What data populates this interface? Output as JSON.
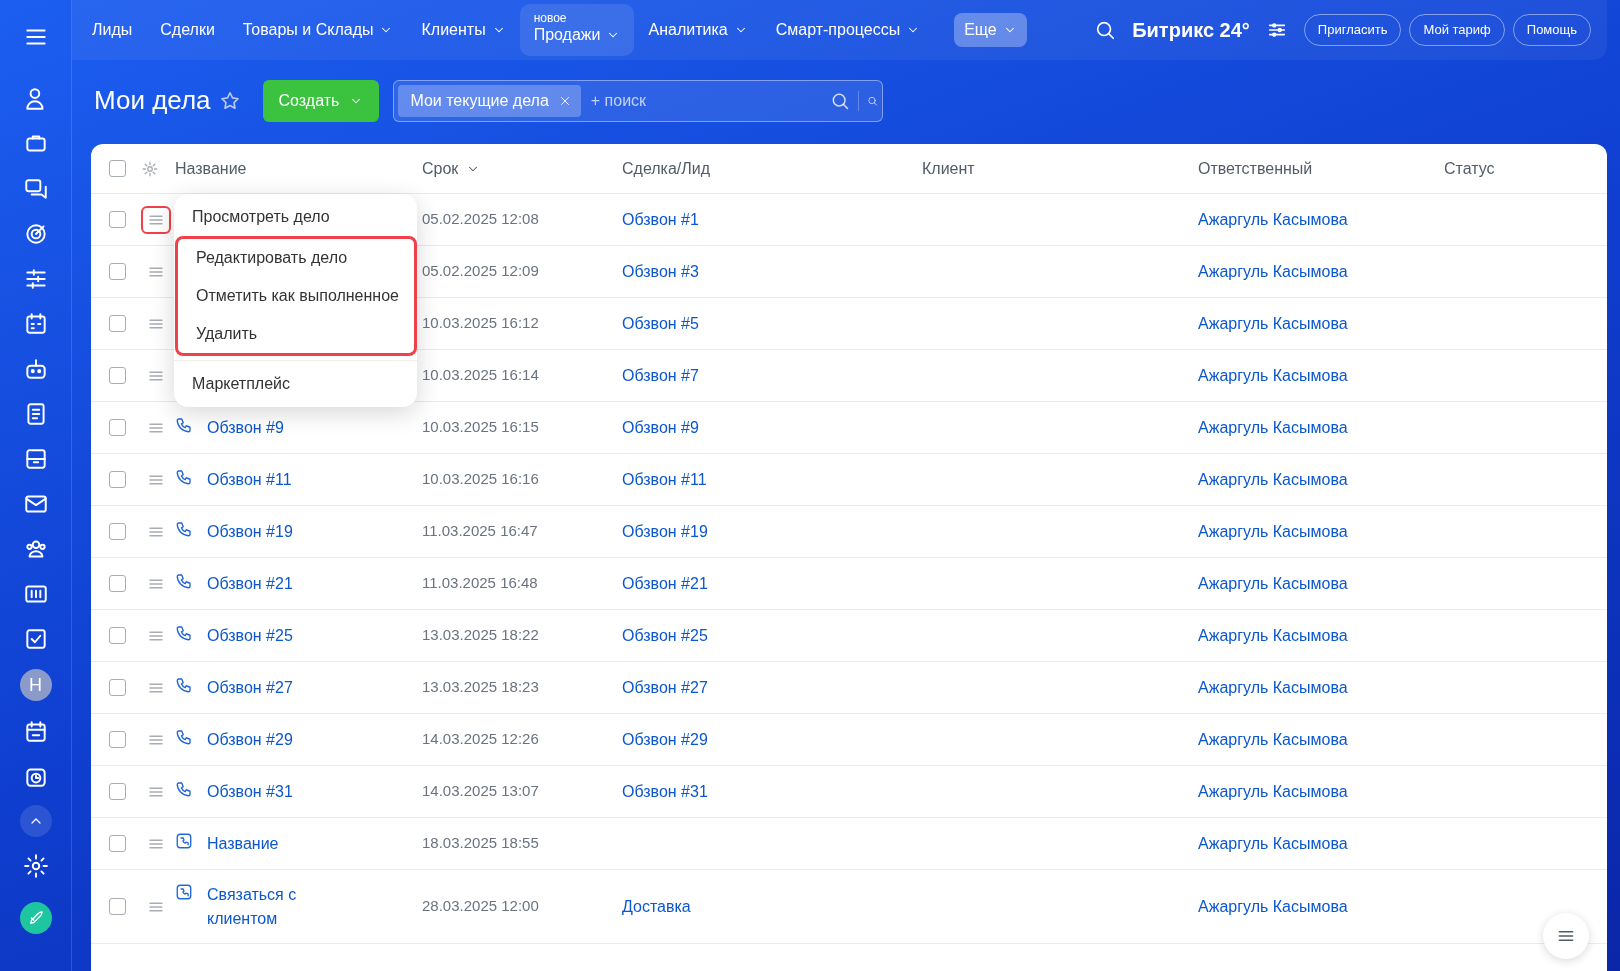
{
  "topbar": {
    "nav": [
      {
        "label": "Лиды",
        "dropdown": false
      },
      {
        "label": "Сделки",
        "dropdown": false
      },
      {
        "label": "Товары и Склады",
        "dropdown": true
      },
      {
        "label": "Клиенты",
        "dropdown": true
      },
      {
        "label": "Продажи",
        "dropdown": true,
        "tag": "новое"
      },
      {
        "label": "Аналитика",
        "dropdown": true
      },
      {
        "label": "Смарт-процессы",
        "dropdown": true
      }
    ],
    "more": "Еще",
    "logo": "Битрикс 24°",
    "buttons": [
      "Пригласить",
      "Мой тариф",
      "Помощь"
    ]
  },
  "sidebar": {
    "avatar": "H"
  },
  "page": {
    "title": "Мои дела",
    "create": "Создать",
    "filter": {
      "chip": "Мои текущие дела",
      "placeholder": "+ поиск"
    }
  },
  "table": {
    "select_all": false,
    "columns": [
      "Название",
      "Срок",
      "Сделка/Лид",
      "Клиент",
      "Ответственный",
      "Статус"
    ],
    "rows": [
      {
        "checked": false,
        "menu_highlighted": true,
        "due": "05.02.2025 12:08",
        "deal": "Обзвон #1",
        "owner": "Ажаргуль Касымова"
      },
      {
        "checked": false,
        "due": "05.02.2025 12:09",
        "deal": "Обзвон #3",
        "owner": "Ажаргуль Касымова"
      },
      {
        "checked": false,
        "due": "10.03.2025 16:12",
        "deal": "Обзвон #5",
        "owner": "Ажаргуль Касымова"
      },
      {
        "checked": false,
        "due": "10.03.2025 16:14",
        "deal": "Обзвон #7",
        "owner": "Ажаргуль Касымова"
      },
      {
        "checked": false,
        "kind": "call",
        "name": "Обзвон #9",
        "due": "10.03.2025 16:15",
        "deal": "Обзвон #9",
        "owner": "Ажаргуль Касымова"
      },
      {
        "checked": false,
        "kind": "call",
        "name": "Обзвон #11",
        "due": "10.03.2025 16:16",
        "deal": "Обзвон #11",
        "owner": "Ажаргуль Касымова"
      },
      {
        "checked": false,
        "kind": "call",
        "name": "Обзвон #19",
        "due": "11.03.2025 16:47",
        "deal": "Обзвон #19",
        "owner": "Ажаргуль Касымова"
      },
      {
        "checked": false,
        "kind": "call",
        "name": "Обзвон #21",
        "due": "11.03.2025 16:48",
        "deal": "Обзвон #21",
        "owner": "Ажаргуль Касымова"
      },
      {
        "checked": false,
        "kind": "call",
        "name": "Обзвон #25",
        "due": "13.03.2025 18:22",
        "deal": "Обзвон #25",
        "owner": "Ажаргуль Касымова"
      },
      {
        "checked": false,
        "kind": "call",
        "name": "Обзвон #27",
        "due": "13.03.2025 18:23",
        "deal": "Обзвон #27",
        "owner": "Ажаргуль Касымова"
      },
      {
        "checked": false,
        "kind": "call",
        "name": "Обзвон #29",
        "due": "14.03.2025 12:26",
        "deal": "Обзвон #29",
        "owner": "Ажаргуль Касымова"
      },
      {
        "checked": false,
        "kind": "call",
        "name": "Обзвон #31",
        "due": "14.03.2025 13:07",
        "deal": "Обзвон #31",
        "owner": "Ажаргуль Касымова"
      },
      {
        "checked": false,
        "kind": "task",
        "name": "Название",
        "due": "18.03.2025 18:55",
        "owner": "Ажаргуль Касымова"
      },
      {
        "checked": false,
        "kind": "task",
        "name": "Связаться с клиентом",
        "due": "28.03.2025 12:00",
        "deal": "Доставка",
        "owner": "Ажаргуль Касымова"
      }
    ]
  },
  "context_menu": [
    {
      "label": "Просмотреть дело",
      "highlighted": false
    },
    {
      "label": "Редактировать дело",
      "highlighted": true
    },
    {
      "label": "Отметить как выполненное",
      "highlighted": true
    },
    {
      "label": "Удалить",
      "highlighted": true
    },
    {
      "label": "Маркетплейс",
      "highlighted": false,
      "separated": true
    }
  ]
}
